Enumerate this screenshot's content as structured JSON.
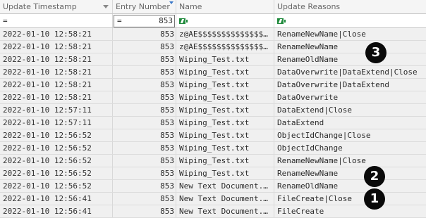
{
  "columns": {
    "timestamp": "Update Timestamp",
    "entry_number": "Entry Number",
    "name": "Name",
    "reasons": "Update Reasons"
  },
  "filters": {
    "timestamp_op": "=",
    "entry_op": "=",
    "entry_value": "853",
    "name_icon": "excel-filter-icon",
    "reasons_icon": "excel-filter-icon"
  },
  "rows": [
    {
      "timestamp": "2022-01-10 12:58:21",
      "entry": "853",
      "name": "z@AE$$$$$$$$$$$$$$$$$$$$",
      "reasons": "RenameNewName|Close"
    },
    {
      "timestamp": "2022-01-10 12:58:21",
      "entry": "853",
      "name": "z@AE$$$$$$$$$$$$$$$$$$$$",
      "reasons": "RenameNewName"
    },
    {
      "timestamp": "2022-01-10 12:58:21",
      "entry": "853",
      "name": "Wiping_Test.txt",
      "reasons": "RenameOldName"
    },
    {
      "timestamp": "2022-01-10 12:58:21",
      "entry": "853",
      "name": "Wiping_Test.txt",
      "reasons": "DataOverwrite|DataExtend|Close"
    },
    {
      "timestamp": "2022-01-10 12:58:21",
      "entry": "853",
      "name": "Wiping_Test.txt",
      "reasons": "DataOverwrite|DataExtend"
    },
    {
      "timestamp": "2022-01-10 12:58:21",
      "entry": "853",
      "name": "Wiping_Test.txt",
      "reasons": "DataOverwrite"
    },
    {
      "timestamp": "2022-01-10 12:57:11",
      "entry": "853",
      "name": "Wiping_Test.txt",
      "reasons": "DataExtend|Close"
    },
    {
      "timestamp": "2022-01-10 12:57:11",
      "entry": "853",
      "name": "Wiping_Test.txt",
      "reasons": "DataExtend"
    },
    {
      "timestamp": "2022-01-10 12:56:52",
      "entry": "853",
      "name": "Wiping_Test.txt",
      "reasons": "ObjectIdChange|Close"
    },
    {
      "timestamp": "2022-01-10 12:56:52",
      "entry": "853",
      "name": "Wiping_Test.txt",
      "reasons": "ObjectIdChange"
    },
    {
      "timestamp": "2022-01-10 12:56:52",
      "entry": "853",
      "name": "Wiping_Test.txt",
      "reasons": "RenameNewName|Close"
    },
    {
      "timestamp": "2022-01-10 12:56:52",
      "entry": "853",
      "name": "Wiping_Test.txt",
      "reasons": "RenameNewName"
    },
    {
      "timestamp": "2022-01-10 12:56:52",
      "entry": "853",
      "name": "New Text Document.txt",
      "reasons": "RenameOldName"
    },
    {
      "timestamp": "2022-01-10 12:56:41",
      "entry": "853",
      "name": "New Text Document.txt",
      "reasons": "FileCreate|Close"
    },
    {
      "timestamp": "2022-01-10 12:56:41",
      "entry": "853",
      "name": "New Text Document.txt",
      "reasons": "FileCreate"
    }
  ],
  "callouts": {
    "one": "1",
    "two": "2",
    "three": "3"
  },
  "colors": {
    "row_bg": "#f0f0f0",
    "callout_bg": "#0a0a0a",
    "sort_indicator": "#3a78c8",
    "excel_icon": "#1f8a3c"
  }
}
